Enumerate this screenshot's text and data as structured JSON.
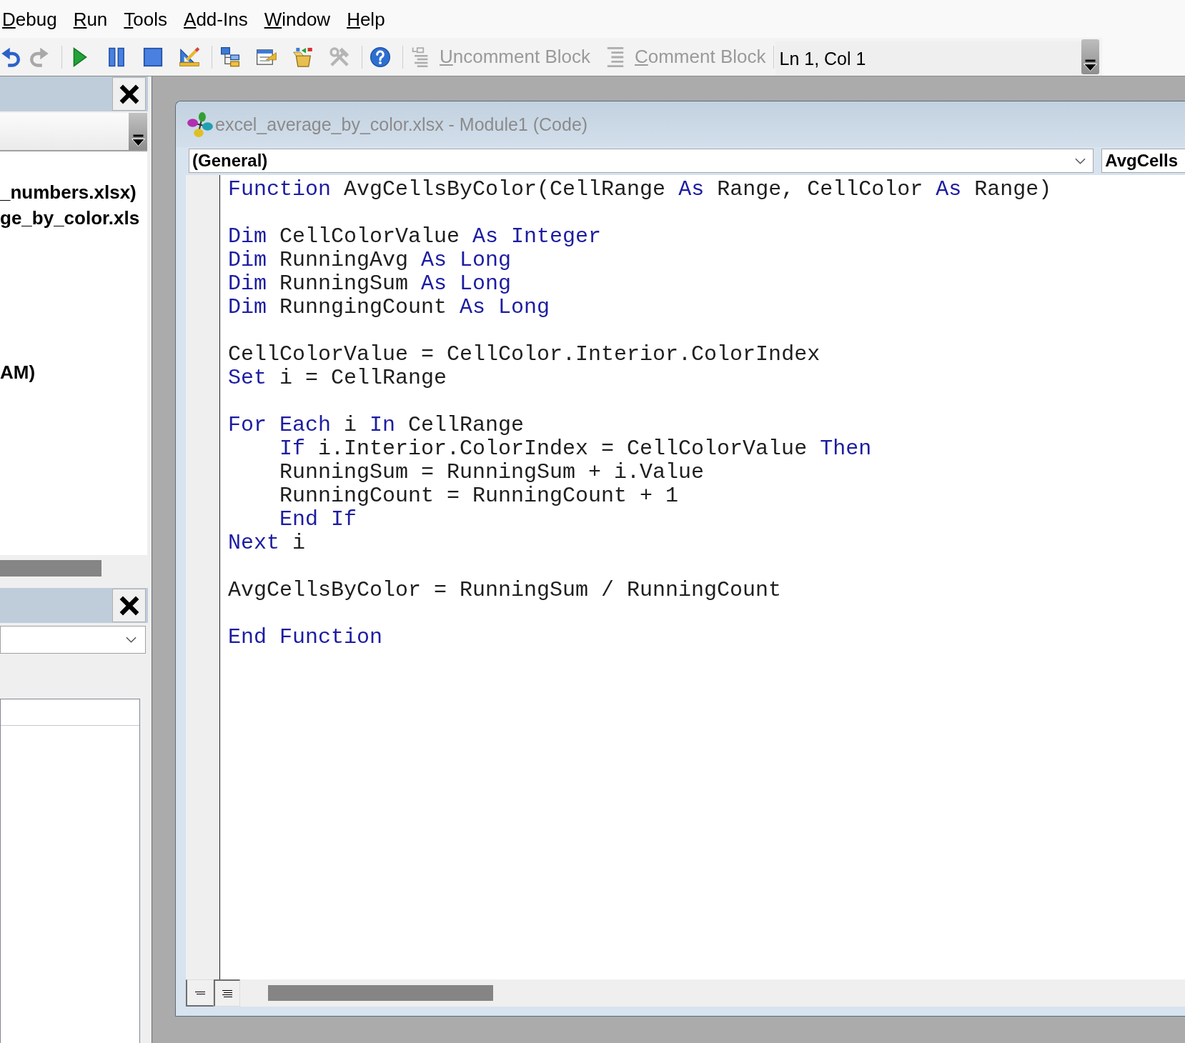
{
  "menu": [
    "Debug",
    "Run",
    "Tools",
    "Add-Ins",
    "Window",
    "Help"
  ],
  "toolbar": {
    "groups": [
      {
        "items": [
          {
            "kind": "undo",
            "disabled": false
          },
          {
            "kind": "redo",
            "disabled": true
          }
        ]
      },
      {
        "items": [
          {
            "kind": "run",
            "disabled": false
          },
          {
            "kind": "pause",
            "disabled": false
          },
          {
            "kind": "stop",
            "disabled": false
          },
          {
            "kind": "design",
            "disabled": false
          }
        ]
      },
      {
        "items": [
          {
            "kind": "project",
            "disabled": false
          },
          {
            "kind": "properties",
            "disabled": false
          },
          {
            "kind": "browser",
            "disabled": false
          },
          {
            "kind": "toolbox",
            "disabled": true
          }
        ]
      },
      {
        "items": [
          {
            "kind": "help",
            "disabled": false
          }
        ]
      },
      {
        "items": [
          {
            "kind": "uncomment",
            "label": "Uncomment Block",
            "disabled": true
          },
          {
            "kind": "comment",
            "label": "Comment Block",
            "disabled": true
          }
        ]
      }
    ],
    "cursor_position": "Ln 1, Col 1"
  },
  "project_explorer": {
    "items": [
      "_numbers.xlsx)",
      "ge_by_color.xls",
      "AM)"
    ]
  },
  "code_window": {
    "title": "excel_average_by_color.xlsx - Module1 (Code)",
    "object_combo": "(General)",
    "procedure_combo": "AvgCells",
    "blocks": [
      {
        "lines": [
          {
            "tokens": [
              {
                "kind": "keyword",
                "text": "Function"
              },
              {
                "kind": "plain",
                "text": " AvgCellsByColor(CellRange "
              },
              {
                "kind": "keyword",
                "text": "As"
              },
              {
                "kind": "plain",
                "text": " Range, CellColor "
              },
              {
                "kind": "keyword",
                "text": "As"
              },
              {
                "kind": "plain",
                "text": " Range)"
              }
            ]
          }
        ]
      },
      {
        "lines": [
          {
            "tokens": [
              {
                "kind": "keyword",
                "text": "Dim"
              },
              {
                "kind": "plain",
                "text": " CellColorValue "
              },
              {
                "kind": "keyword",
                "text": "As Integer"
              }
            ]
          },
          {
            "tokens": [
              {
                "kind": "keyword",
                "text": "Dim"
              },
              {
                "kind": "plain",
                "text": " RunningAvg "
              },
              {
                "kind": "keyword",
                "text": "As Long"
              }
            ]
          },
          {
            "tokens": [
              {
                "kind": "keyword",
                "text": "Dim"
              },
              {
                "kind": "plain",
                "text": " RunningSum "
              },
              {
                "kind": "keyword",
                "text": "As Long"
              }
            ]
          },
          {
            "tokens": [
              {
                "kind": "keyword",
                "text": "Dim"
              },
              {
                "kind": "plain",
                "text": " RunngingCount "
              },
              {
                "kind": "keyword",
                "text": "As Long"
              }
            ]
          }
        ]
      },
      {
        "lines": [
          {
            "tokens": [
              {
                "kind": "plain",
                "text": "CellColorValue = CellColor.Interior.ColorIndex"
              }
            ]
          },
          {
            "tokens": [
              {
                "kind": "keyword",
                "text": "Set"
              },
              {
                "kind": "plain",
                "text": " i = CellRange"
              }
            ]
          }
        ]
      },
      {
        "lines": [
          {
            "tokens": [
              {
                "kind": "keyword",
                "text": "For Each"
              },
              {
                "kind": "plain",
                "text": " i "
              },
              {
                "kind": "keyword",
                "text": "In"
              },
              {
                "kind": "plain",
                "text": " CellRange"
              }
            ],
            "children": [
              {
                "tokens": [
                  {
                    "kind": "keyword",
                    "text": "If"
                  },
                  {
                    "kind": "plain",
                    "text": " i.Interior.ColorIndex = CellColorValue "
                  },
                  {
                    "kind": "keyword",
                    "text": "Then"
                  }
                ]
              },
              {
                "tokens": [
                  {
                    "kind": "plain",
                    "text": "RunningSum = RunningSum + i.Value"
                  }
                ]
              },
              {
                "tokens": [
                  {
                    "kind": "plain",
                    "text": "RunningCount = RunningCount + 1"
                  }
                ]
              },
              {
                "tokens": [
                  {
                    "kind": "keyword",
                    "text": "End If"
                  }
                ]
              }
            ]
          },
          {
            "tokens": [
              {
                "kind": "keyword",
                "text": "Next"
              },
              {
                "kind": "plain",
                "text": " i"
              }
            ]
          }
        ]
      },
      {
        "lines": [
          {
            "tokens": [
              {
                "kind": "plain",
                "text": "AvgCellsByColor = RunningSum / RunningCount"
              }
            ]
          }
        ]
      },
      {
        "lines": [
          {
            "tokens": [
              {
                "kind": "keyword",
                "text": "End Function"
              }
            ]
          }
        ]
      }
    ]
  }
}
